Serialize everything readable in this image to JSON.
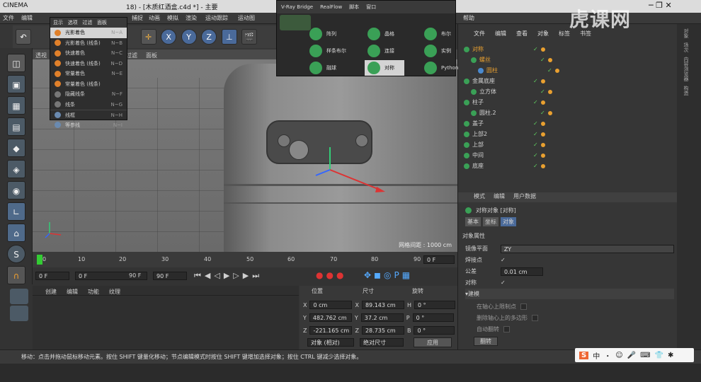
{
  "window": {
    "title": "CINEMA 4D R18 - [木质红酒盒.c4d *] - 主要",
    "title_prefix": "CINEMA",
    "title_main": "18) - [木质红酒盒.c4d *] - 主要"
  },
  "menubar": [
    "文件",
    "编辑",
    "",
    "",
    "",
    "",
    "捕捉",
    "动画",
    "模拟",
    "渲染",
    "运动跟踪",
    "运动图",
    "帮助"
  ],
  "display_menu": {
    "tabs": [
      "显示",
      "选项",
      "过滤",
      "面板"
    ],
    "items": [
      {
        "label": "光影着色",
        "shortcut": "N~A",
        "selected": true
      },
      {
        "label": "光影着色 (线条)",
        "shortcut": "N~B"
      },
      {
        "label": "快速着色",
        "shortcut": "N~C"
      },
      {
        "label": "快速着色 (线条)",
        "shortcut": "N~D"
      },
      {
        "label": "常量着色",
        "shortcut": "N~E"
      },
      {
        "label": "常量着色 (线条)",
        "shortcut": ""
      },
      {
        "label": "隐藏线条",
        "shortcut": "N~F"
      },
      {
        "label": "线条",
        "shortcut": "N~G"
      },
      {
        "label": "线框",
        "shortcut": "N~H"
      },
      {
        "label": "等参线",
        "shortcut": "N~I"
      }
    ]
  },
  "vray": {
    "tabs": [
      "V-Ray Bridge",
      "RealFlow",
      "脚本",
      "窗口"
    ],
    "items": [
      "阵列",
      "晶格",
      "布尔",
      "样条布尔",
      "连接",
      "实例",
      "融球",
      "对称",
      "Python"
    ]
  },
  "toolbar": {
    "axis_labels": [
      "X",
      "Y",
      "Z"
    ]
  },
  "viewport": {
    "label": "透视",
    "tabs": [
      "过滤",
      "面板"
    ],
    "grid_spacing": "网格间距 : 1000 cm"
  },
  "timeline": {
    "ticks": [
      "0",
      "10",
      "20",
      "30",
      "40",
      "50",
      "60",
      "70",
      "80",
      "90"
    ],
    "start": "0 F",
    "end": "0 F"
  },
  "transport": {
    "current": "0 F",
    "from": "0 F",
    "to": "90 F",
    "max": "90 F"
  },
  "material_menu": [
    "创建",
    "编辑",
    "功能",
    "纹理"
  ],
  "coords": {
    "headers": [
      "位置",
      "尺寸",
      "旋转"
    ],
    "rows": [
      {
        "axis": "X",
        "pos": "0 cm",
        "size": "89.143 cm",
        "rot_axis": "H",
        "rot": "0 °"
      },
      {
        "axis": "Y",
        "pos": "482.762 cm",
        "size": "37.2 cm",
        "rot_axis": "P",
        "rot": "0 °"
      },
      {
        "axis": "Z",
        "pos": "-221.165 cm",
        "size": "28.735 cm",
        "rot_axis": "B",
        "rot": "0 °"
      }
    ],
    "mode": "对象 (相对)",
    "size_mode": "绝对尺寸",
    "apply": "应用"
  },
  "objects": {
    "menu": [
      "文件",
      "编辑",
      "查看",
      "对象",
      "标签",
      "书签"
    ],
    "items": [
      {
        "name": "对称",
        "indent": 0,
        "active": true
      },
      {
        "name": "螺丝",
        "indent": 1,
        "active": true
      },
      {
        "name": "圆柱",
        "indent": 2,
        "active": true
      },
      {
        "name": "金属底座",
        "indent": 0,
        "active": false
      },
      {
        "name": "立方体",
        "indent": 1,
        "active": false
      },
      {
        "name": "柱子",
        "indent": 0,
        "active": false
      },
      {
        "name": "圆柱.2",
        "indent": 1,
        "active": false
      },
      {
        "name": "盖子",
        "indent": 0,
        "active": false
      },
      {
        "name": "上部2",
        "indent": 0,
        "active": false
      },
      {
        "name": "上部",
        "indent": 0,
        "active": false
      },
      {
        "name": "中间",
        "indent": 0,
        "active": false
      },
      {
        "name": "底座",
        "indent": 0,
        "active": false
      }
    ]
  },
  "attributes": {
    "menu": [
      "模式",
      "编辑",
      "用户数据"
    ],
    "object_title": "对称对象 [对称]",
    "tabs": [
      "基本",
      "坐标",
      "对象"
    ],
    "section": "对象属性",
    "mirror_plane_label": "镜像平面",
    "mirror_plane": "ZY",
    "weld_label": "焊接点",
    "weld": "✓",
    "tolerance_label": "公差",
    "tolerance": "0.01 cm",
    "sym_label": "对称",
    "sym": "✓",
    "subsection": "▾建模",
    "opts": [
      "在轴心上限制点",
      "删除轴心上的多边形",
      "自动翻转"
    ],
    "flip": "翻转"
  },
  "right_tabs": [
    "对象",
    "场次",
    "内容浏览器",
    "构造"
  ],
  "status": "移动：点击并拖动鼠标移动元素。按住 SHIFT 键量化移动；节点编辑模式时按住 SHIFT 键增加选择对象；按住 CTRL 键减少选择对象。",
  "watermark": "虎课网",
  "ime": [
    "S",
    "中",
    "・",
    "☺",
    "🎤",
    "⌨",
    "👕",
    "✱"
  ],
  "colors": {
    "accent": "#e9a030",
    "check": "#5fce5f",
    "selected": "#d4d4d4"
  }
}
